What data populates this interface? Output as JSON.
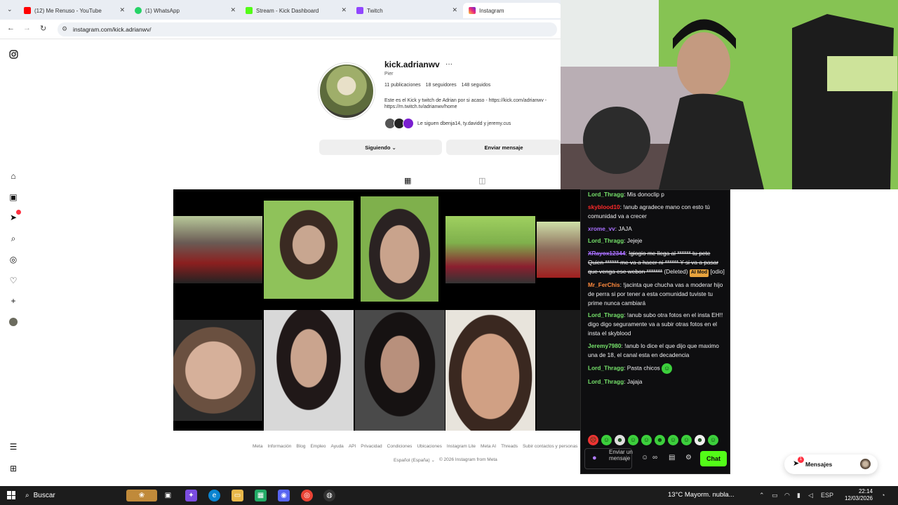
{
  "browser": {
    "tabs": [
      {
        "title": "(12) Me Renuso - YouTube",
        "color": "#ff0000"
      },
      {
        "title": "(1) WhatsApp",
        "color": "#25d366"
      },
      {
        "title": "Stream - Kick Dashboard",
        "color": "#53fc18"
      },
      {
        "title": "Twitch",
        "color": "#9146ff"
      },
      {
        "title": "Instagram",
        "color": "#e1306c"
      }
    ],
    "url": "instagram.com/kick.adrianwv/"
  },
  "profile": {
    "username": "kick.adrianwv",
    "more": "···",
    "full_name": "Pier",
    "posts": "11 publicaciones",
    "followers": "18 seguidores",
    "following": "148 seguidos",
    "bio_line1": "Este es el Kick y twitch de Adrian por si acaso - https://kick.com/adrianwv -",
    "bio_line2": "https://m.twitch.tv/adrianwv/home",
    "followed_by": "Le siguen dbenja14, ty.davidd  y jeremy.cus",
    "following_button": "Siguiendo ⌄",
    "message_button": "Enviar mensaje"
  },
  "chat": {
    "messages": [
      {
        "user": "Lord_Thragg",
        "color": "#76e36b",
        "text": "Mis donoclip p"
      },
      {
        "user": "skyblood10",
        "color": "#ff2a2a",
        "text": "!anub agradece mano con esto tú comunidad va a crecer"
      },
      {
        "user": "xrome_vv",
        "color": "#a970ff",
        "text": "JAJA"
      },
      {
        "user": "Lord_Thragg",
        "color": "#76e36b",
        "text": "Jejeje"
      },
      {
        "user": "XRayox12344",
        "color": "#a970ff",
        "text": "!giogio me llega al ****** tu pete Quien ****** me va a hacer ni ****** Y si va a pasar que venga ese webon *******",
        "deleted": "(Deleted)",
        "tag": "AI Mod",
        "tail": "[odio]"
      },
      {
        "user": "Mr_FerChis",
        "color": "#ff8a3d",
        "text": "!jacinta que chucha vas a moderar hijo de perra si por tener a esta comunidad tuviste tu prime nunca cambiará"
      },
      {
        "user": "Lord_Thragg",
        "color": "#76e36b",
        "text": "!anub subo otra fotos en el insta EH!! digo digo seguramente va a subir otras fotos en el insta el skyblood"
      },
      {
        "user": "Jeremy7980",
        "color": "#76e36b",
        "text": "!anub lo dice el que dijo que maximo una de 18, el canal esta en decadencia"
      },
      {
        "user": "Lord_Thragg",
        "color": "#76e36b",
        "text": "Pasta chicos"
      },
      {
        "user": "Lord_Thragg",
        "color": "#76e36b",
        "text": "Jajaja"
      }
    ],
    "placeholder": "Enviar un mensaje",
    "chat_button": "Chat"
  },
  "footer": {
    "links": [
      "Meta",
      "Información",
      "Blog",
      "Empleo",
      "Ayuda",
      "API",
      "Privacidad",
      "Condiciones",
      "Ubicaciones",
      "Instagram Lite",
      "Meta AI",
      "Threads",
      "Subir contactos y personas"
    ],
    "language": "Español (España) ⌄",
    "copyright": "© 2026 Instagram from Meta"
  },
  "messages_pill": {
    "label": "Mensajes",
    "count": "1"
  },
  "taskbar": {
    "search": "Buscar",
    "weather": "13°C  Mayorm. nubla...",
    "lang": "ESP",
    "time": "22:14",
    "date": "12/03/2026"
  }
}
